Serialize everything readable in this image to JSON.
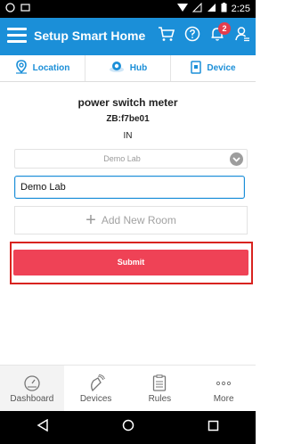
{
  "status_bar": {
    "time": "2:25"
  },
  "app_bar": {
    "title": "Setup Smart Home",
    "notification_count": "2"
  },
  "tabs": [
    {
      "label": "Location",
      "icon": "location-pin-icon"
    },
    {
      "label": "Hub",
      "icon": "hub-icon"
    },
    {
      "label": "Device",
      "icon": "device-icon"
    }
  ],
  "device": {
    "name": "power switch meter",
    "id": "ZB:f7be01",
    "room_code": "IN"
  },
  "room_select": {
    "value": "Demo Lab"
  },
  "room_input": {
    "value": "Demo Lab"
  },
  "add_room": {
    "label": "Add New Room"
  },
  "submit": {
    "label": "Submit"
  },
  "bottom_nav": {
    "items": [
      {
        "label": "Dashboard",
        "icon": "dashboard-icon"
      },
      {
        "label": "Devices",
        "icon": "devices-icon"
      },
      {
        "label": "Rules",
        "icon": "rules-icon"
      },
      {
        "label": "More",
        "icon": "more-icon"
      }
    ]
  },
  "colors": {
    "primary": "#1b8fd8",
    "submit": "#ef4256",
    "highlight": "#d8231f"
  }
}
